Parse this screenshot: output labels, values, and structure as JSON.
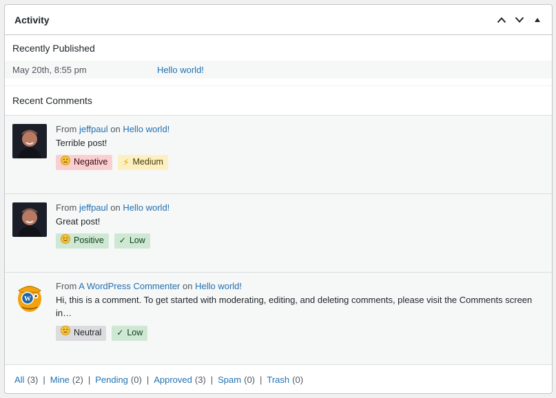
{
  "widget": {
    "title": "Activity"
  },
  "header_controls": [
    "move-up",
    "move-down",
    "toggle-panel"
  ],
  "recently_published": {
    "title": "Recently Published",
    "items": [
      {
        "date": "May 20th, 8:55 pm",
        "title": "Hello world!"
      }
    ]
  },
  "recent_comments": {
    "title": "Recent Comments",
    "items": [
      {
        "from_label": "From",
        "author": "jeffpaul",
        "on_label": "on",
        "post": "Hello world!",
        "text": "Terrible post!",
        "tags": [
          {
            "label": "Negative",
            "icon": "frown-emoji-icon"
          },
          {
            "label": "Medium",
            "icon": "lightning-bolt-icon"
          }
        ]
      },
      {
        "from_label": "From",
        "author": "jeffpaul",
        "on_label": "on",
        "post": "Hello world!",
        "text": "Great post!",
        "tags": [
          {
            "label": "Positive",
            "icon": "smile-emoji-icon"
          },
          {
            "label": "Low",
            "icon": "check-icon"
          }
        ]
      },
      {
        "from_label": "From",
        "author": "A WordPress Commenter",
        "on_label": "on",
        "post": "Hello world!",
        "text": "Hi, this is a comment. To get started with moderating, editing, and deleting comments, please visit the Comments screen in…",
        "tags": [
          {
            "label": "Neutral",
            "icon": "neutral-emoji-icon"
          },
          {
            "label": "Low",
            "icon": "check-icon"
          }
        ]
      }
    ]
  },
  "footer_links": [
    {
      "label": "All",
      "count": "(3)"
    },
    {
      "label": "Mine",
      "count": "(2)"
    },
    {
      "label": "Pending",
      "count": "(0)"
    },
    {
      "label": "Approved",
      "count": "(3)"
    },
    {
      "label": "Spam",
      "count": "(0)"
    },
    {
      "label": "Trash",
      "count": "(0)"
    }
  ],
  "colors": {
    "link": "#2271b1",
    "negative_bg": "#facfd2",
    "medium_bg": "#fcf0c3",
    "positive_bg": "#cfe8d4",
    "neutral_bg": "#dcdcde"
  }
}
